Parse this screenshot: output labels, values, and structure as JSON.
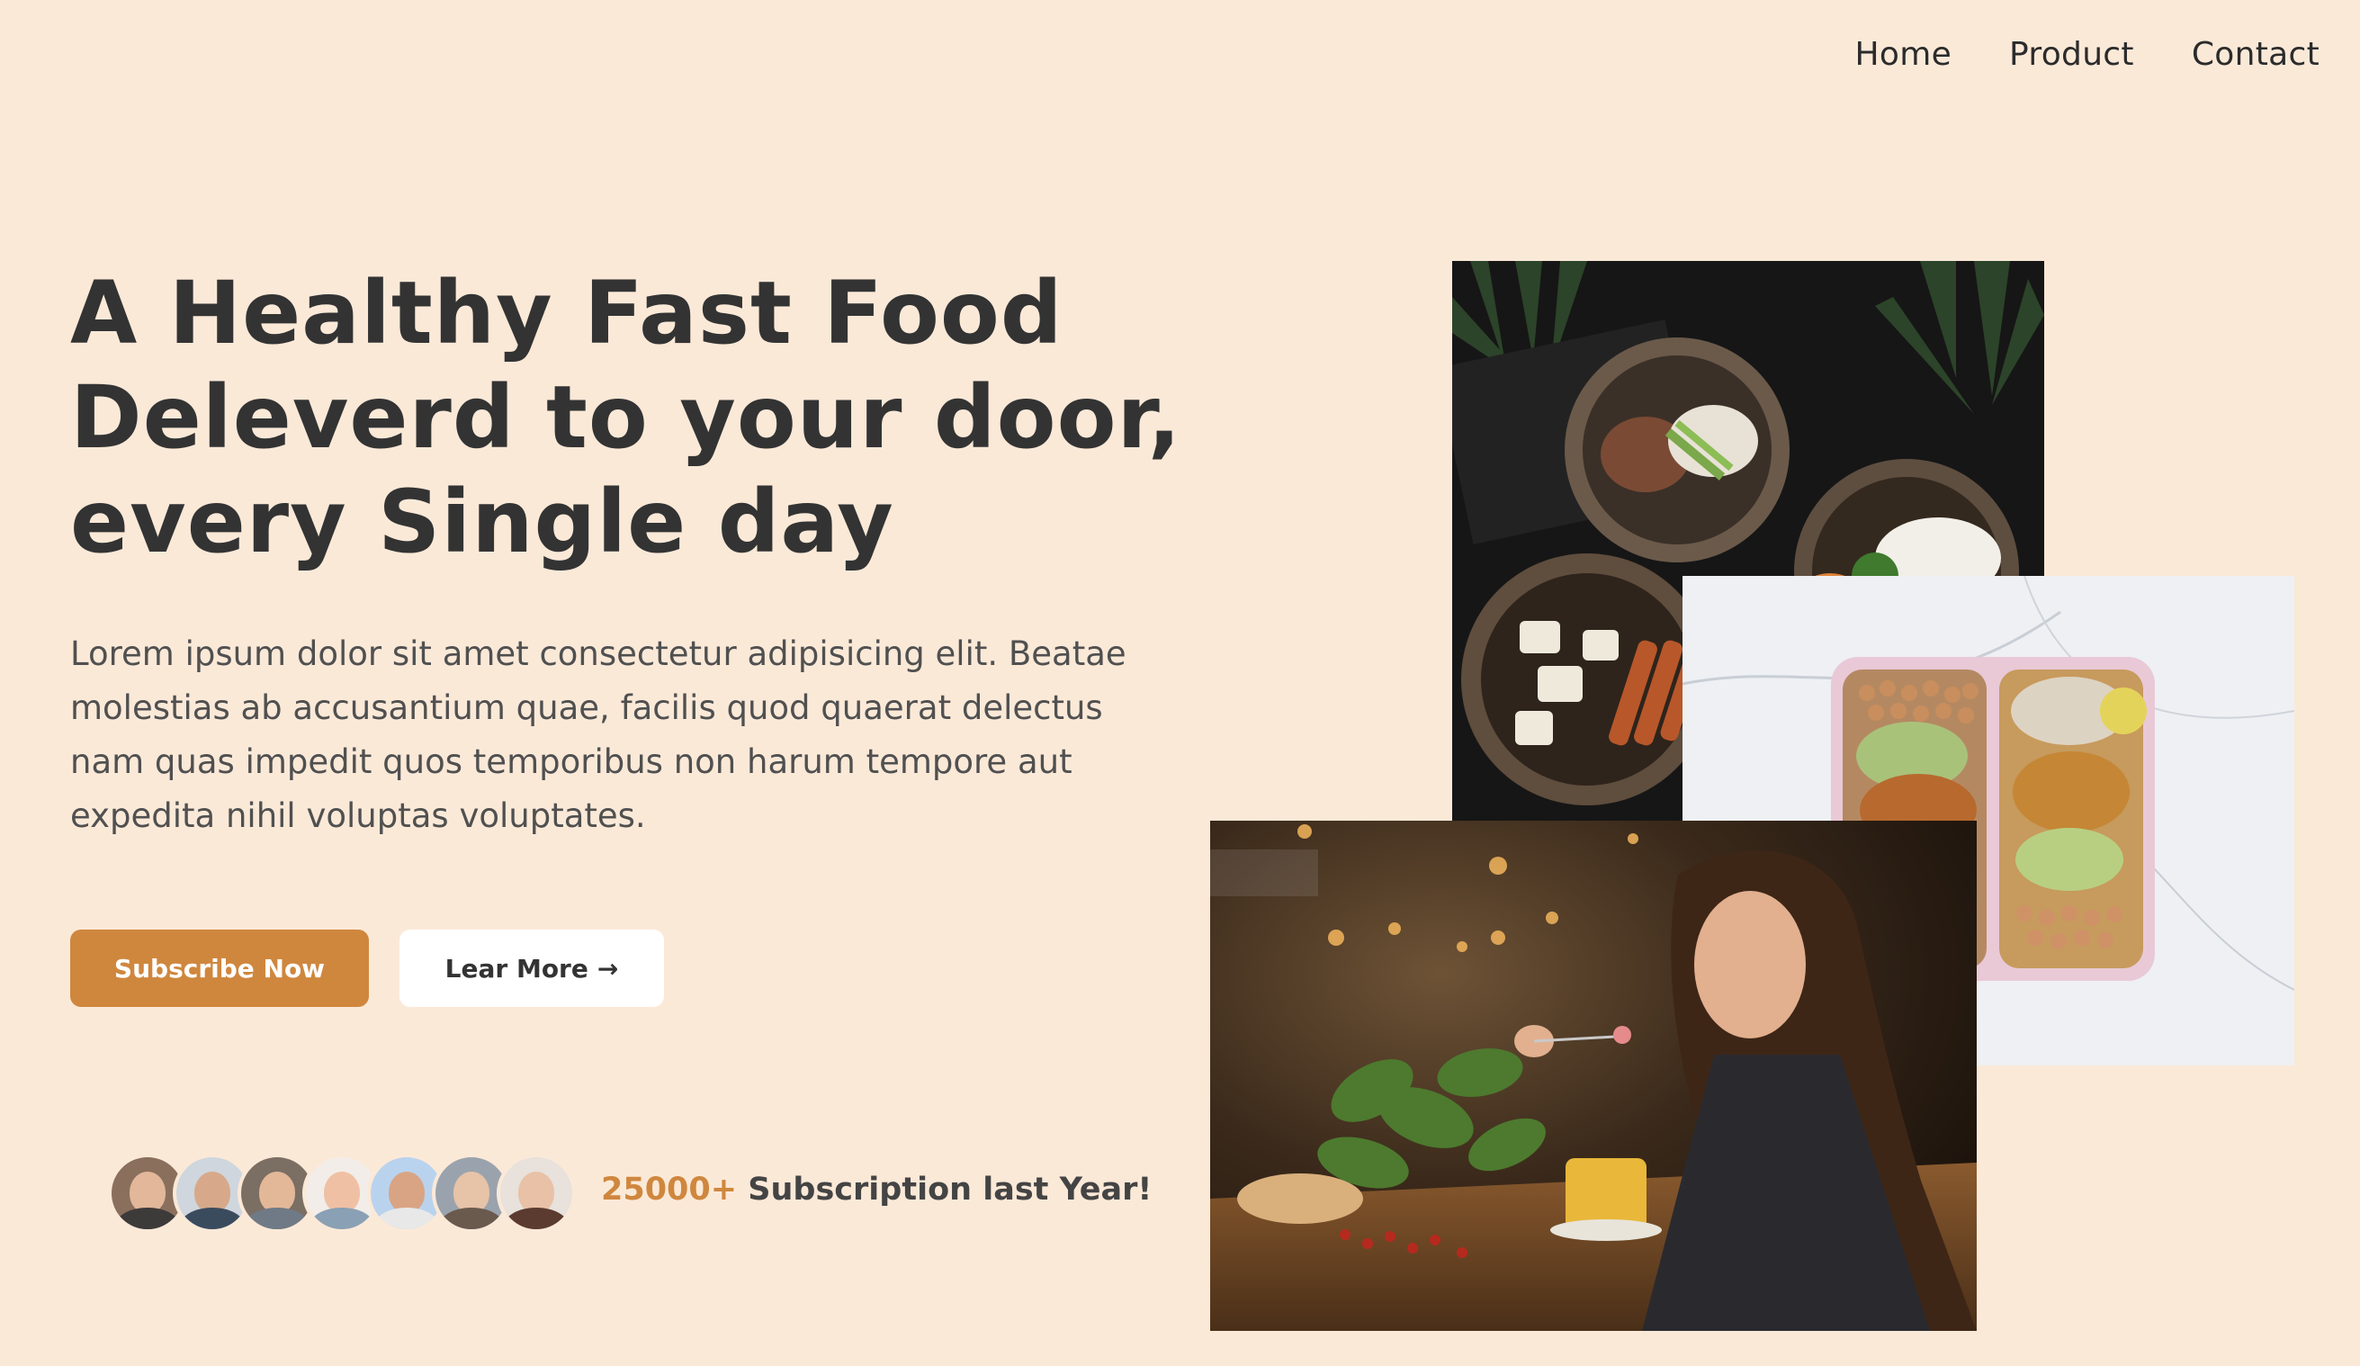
{
  "nav": {
    "items": [
      "Home",
      "Product",
      "Contact"
    ]
  },
  "hero": {
    "title_line1": "A Healthy Fast Food",
    "title_line2": "Deleverd to your door,",
    "title_line3": "every Single day",
    "description": "Lorem ipsum dolor sit amet consectetur adipisicing elit. Beatae molestias ab accusantium quae, facilis quod quaerat delectus nam quas impedit quos temporibus non harum tempore aut expedita nihil voluptas voluptates."
  },
  "buttons": {
    "subscribe_label": "Subscribe Now",
    "learn_more_label": "Lear More",
    "learn_more_arrow": "→"
  },
  "subscribers": {
    "count": "25000+",
    "text": "Subscription last Year!"
  },
  "colors": {
    "background": "#fbe9d8",
    "accent": "#cf873e",
    "text": "#333333"
  }
}
